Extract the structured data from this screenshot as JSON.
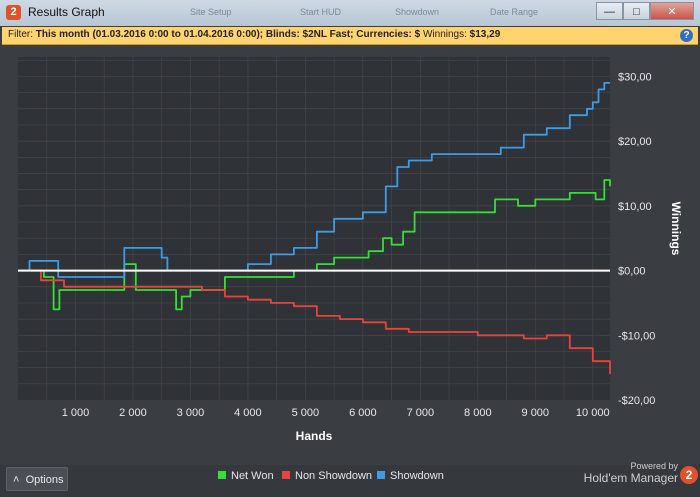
{
  "window": {
    "title": "Results Graph",
    "background_tabs": [
      "Site Setup",
      "Start HUD",
      "Showdown",
      "Date Range"
    ],
    "min_icon": "minimize-icon",
    "max_icon": "maximize-icon",
    "close_icon": "close-icon"
  },
  "filter": {
    "prefix": "Filter: ",
    "text": "This month (01.03.2016 0:00 to 01.04.2016 0:00); Blinds: $2NL Fast; Currencies: $",
    "winnings_label": " Winnings: ",
    "winnings_value": "$13,29",
    "help_glyph": "?"
  },
  "footer": {
    "options_label": "Options",
    "powered_by": "Powered by",
    "product": "Hold'em Manager",
    "badge": "2"
  },
  "colors": {
    "net_won": "#33e033",
    "non_showdown": "#e8443d",
    "showdown": "#3d9ce6",
    "zero_line": "#ffffff",
    "plot_bg": "#2f3236",
    "grid": "#44474c"
  },
  "chart_data": {
    "type": "line",
    "xlabel": "Hands",
    "ylabel": "Winnings",
    "xlim": [
      0,
      10300
    ],
    "ylim": [
      -20,
      33
    ],
    "x_ticks": [
      1000,
      2000,
      3000,
      4000,
      5000,
      6000,
      7000,
      8000,
      9000,
      10000
    ],
    "x_tick_labels": [
      "1 000",
      "2 000",
      "3 000",
      "4 000",
      "5 000",
      "6 000",
      "7 000",
      "8 000",
      "9 000",
      "10 000"
    ],
    "y_ticks": [
      30,
      20,
      10,
      0,
      -10,
      -20
    ],
    "y_tick_labels": [
      "$30,00",
      "$20,00",
      "$10,00",
      "$0,00",
      "-$10,00",
      "-$20,00"
    ],
    "legend": [
      "Net Won",
      "Non Showdown",
      "Showdown"
    ],
    "legend_position": "bottom",
    "series": [
      {
        "name": "Net Won",
        "x": [
          0,
          200,
          450,
          620,
          720,
          1000,
          1400,
          1800,
          1850,
          2050,
          2600,
          2750,
          2850,
          3000,
          3300,
          3600,
          4000,
          4400,
          4800,
          5200,
          5500,
          5800,
          6100,
          6350,
          6500,
          6700,
          6900,
          7200,
          7600,
          8000,
          8300,
          8700,
          9000,
          9300,
          9600,
          9900,
          10050,
          10200,
          10300
        ],
        "y": [
          0,
          0,
          -1,
          -6,
          -3,
          -3,
          -3,
          -3,
          1,
          -3,
          -3,
          -6,
          -4,
          -3,
          -3,
          -1,
          -1,
          -1,
          0,
          1,
          2,
          2,
          3,
          5,
          4,
          6,
          9,
          9,
          9,
          9,
          11,
          10,
          11,
          11,
          12,
          12,
          11,
          14,
          13
        ]
      },
      {
        "name": "Non Showdown",
        "x": [
          0,
          400,
          800,
          1200,
          1600,
          2000,
          2400,
          2800,
          3200,
          3600,
          4000,
          4400,
          4800,
          5200,
          5600,
          6000,
          6400,
          6800,
          7200,
          7600,
          8000,
          8400,
          8800,
          9200,
          9600,
          10000,
          10300
        ],
        "y": [
          0,
          -1.5,
          -2.5,
          -2.5,
          -2.5,
          -2.5,
          -2.5,
          -2.5,
          -3,
          -4,
          -4.5,
          -5,
          -5.5,
          -7,
          -7.5,
          -8,
          -9,
          -9.5,
          -9.5,
          -9.5,
          -10,
          -10,
          -10.5,
          -10,
          -12,
          -14,
          -16
        ]
      },
      {
        "name": "Showdown",
        "x": [
          0,
          200,
          400,
          700,
          1000,
          1400,
          1800,
          1850,
          2100,
          2500,
          2600,
          2900,
          3100,
          3300,
          3600,
          4000,
          4400,
          4800,
          5200,
          5500,
          6000,
          6400,
          6600,
          6800,
          7200,
          7600,
          8000,
          8400,
          8800,
          9200,
          9600,
          9900,
          10000,
          10100,
          10200,
          10300
        ],
        "y": [
          0,
          1.5,
          1.5,
          -1,
          -1,
          -1,
          -1,
          3.5,
          3.5,
          2,
          0,
          0,
          0,
          0,
          0,
          1,
          2.5,
          3.5,
          6,
          8,
          9,
          13,
          16,
          17,
          18,
          18,
          18,
          19,
          21,
          22,
          24,
          25,
          26,
          28,
          29,
          29
        ]
      }
    ]
  }
}
